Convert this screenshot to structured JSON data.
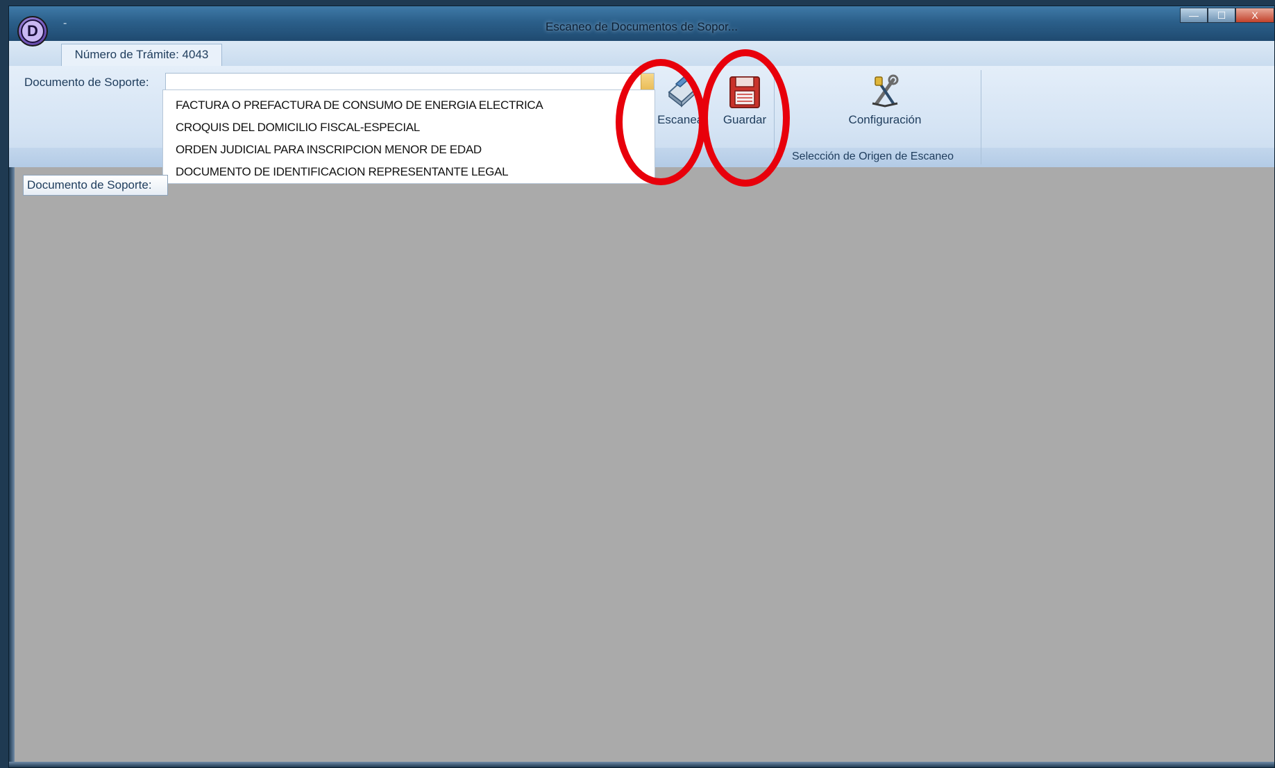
{
  "window": {
    "title": "Escaneo de Documentos de Sopor...",
    "quick_access": "-",
    "app_icon_letter": "D",
    "controls": {
      "minimize": "—",
      "maximize": "☐",
      "close": "X"
    }
  },
  "tabs": [
    {
      "label": "Número de Trámite: 4043",
      "active": true
    }
  ],
  "ribbon": {
    "document_label": "Documento de Soporte:",
    "buttons": {
      "scan": "Escanear",
      "save": "Guardar",
      "configuration": "Configuración"
    },
    "group_label": "Selección de Origen de Escaneo"
  },
  "dropdown": {
    "options": [
      "FACTURA O PREFACTURA DE CONSUMO DE ENERGIA ELECTRICA",
      "CROQUIS DEL DOMICILIO FISCAL-ESPECIAL",
      "ORDEN JUDICIAL PARA INSCRIPCION MENOR DE EDAD",
      "DOCUMENTO DE IDENTIFICACION REPRESENTANTE LEGAL"
    ]
  },
  "tooltip": {
    "text": "Documento de Soporte:"
  },
  "annotations": {
    "highlight_color": "#e8000b"
  },
  "colors": {
    "titlebar": "#2b5f8a",
    "ribbon": "#d5e4f4",
    "workarea": "#aaaaaa"
  }
}
